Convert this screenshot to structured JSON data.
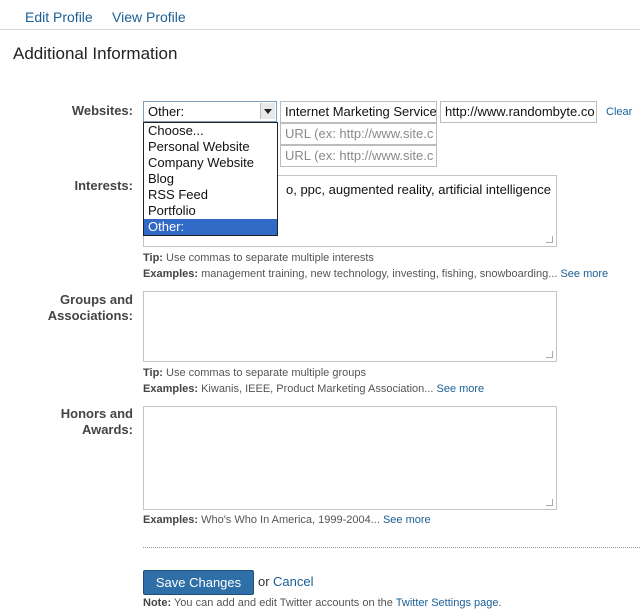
{
  "tabs": {
    "edit_profile": "Edit Profile",
    "view_profile": "View Profile"
  },
  "section_title": "Additional Information",
  "websites": {
    "label": "Websites:",
    "selected": "Other:",
    "options": [
      "Choose...",
      "Personal Website",
      "Company Website",
      "Blog",
      "RSS Feed",
      "Portfolio",
      "Other:"
    ],
    "highlighted_option": "Other:",
    "rows": [
      {
        "name": "Internet Marketing Service",
        "url": "http://www.randombyte.co"
      },
      {
        "url_placeholder": "URL (ex: http://www.site.c"
      },
      {
        "url_placeholder": "URL (ex: http://www.site.c"
      }
    ],
    "clear": "Clear"
  },
  "interests": {
    "label": "Interests:",
    "value_visible": "o, ppc, augmented reality, artificial intelligence",
    "tip_label": "Tip:",
    "tip_text": "Use commas to separate multiple interests",
    "examples_label": "Examples:",
    "examples_text": "management training, new technology, investing, fishing, snowboarding...",
    "see_more": "See more"
  },
  "groups": {
    "label_line1": "Groups and",
    "label_line2": "Associations:",
    "tip_label": "Tip:",
    "tip_text": "Use commas to separate multiple groups",
    "examples_label": "Examples:",
    "examples_text": "Kiwanis, IEEE, Product Marketing Association...",
    "see_more": "See more"
  },
  "honors": {
    "label_line1": "Honors and",
    "label_line2": "Awards:",
    "examples_label": "Examples:",
    "examples_text": "Who's Who In America, 1999-2004...",
    "see_more": "See more"
  },
  "actions": {
    "save": "Save Changes",
    "or": "or",
    "cancel": "Cancel",
    "note_label": "Note:",
    "note_text": "You can add and edit Twitter accounts on the",
    "note_link": "Twitter Settings page",
    "note_end": "."
  },
  "colors": {
    "link": "#1a5f96",
    "button": "#2e6fa8",
    "highlight": "#3169c6"
  }
}
